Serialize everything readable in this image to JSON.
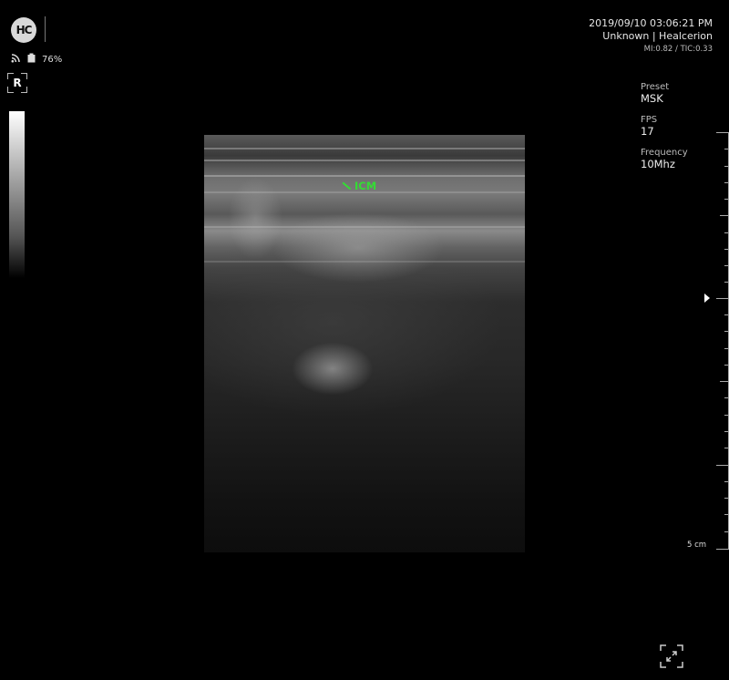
{
  "header": {
    "logo_text": "HC",
    "battery_percent": "76%",
    "orientation_marker": "R",
    "datetime": "2019/09/10 03:06:21 PM",
    "patient_info": "Unknown | Healcerion",
    "mi_tic": "MI:0.82 / TIC:0.33"
  },
  "params": [
    {
      "label": "Preset",
      "value": "MSK"
    },
    {
      "label": "FPS",
      "value": "17"
    },
    {
      "label": "Frequency",
      "value": "10Mhz"
    }
  ],
  "image": {
    "annotation": "ICM",
    "annotation_color": "#33dd33"
  },
  "ruler": {
    "depth_label": "5 cm"
  },
  "icons": {
    "wifi": "wifi-icon",
    "battery": "battery-icon",
    "fullscreen": "fullscreen-icon",
    "focus": "focus-marker-icon"
  }
}
